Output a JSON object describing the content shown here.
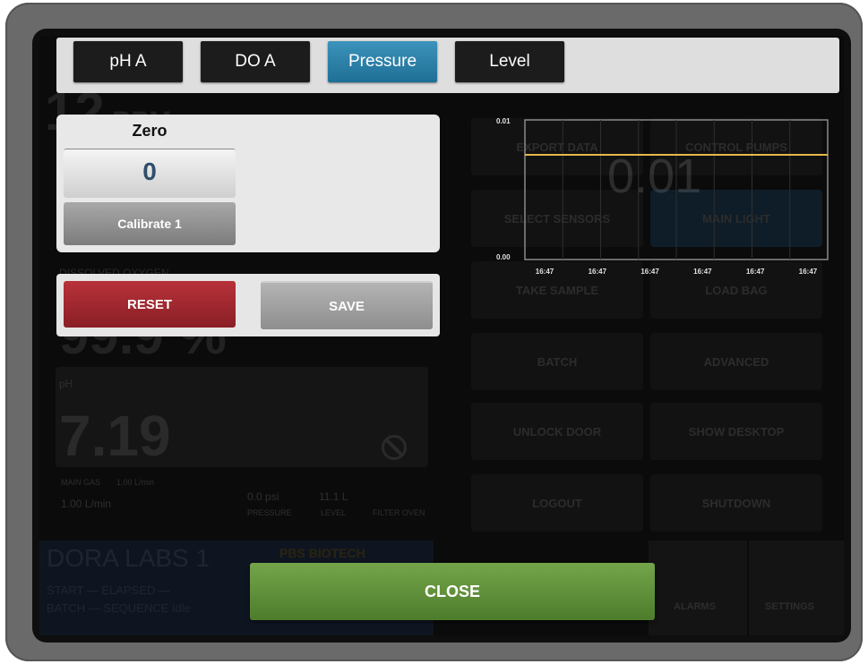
{
  "tabs": [
    {
      "label": "pH A",
      "active": false
    },
    {
      "label": "DO A",
      "active": false
    },
    {
      "label": "Pressure",
      "active": true
    },
    {
      "label": "Level",
      "active": false
    }
  ],
  "calibration": {
    "zero_title": "Zero",
    "zero_value": "0",
    "calibrate_label": "Calibrate 1"
  },
  "actions": {
    "reset_label": "RESET",
    "save_label": "SAVE"
  },
  "close_label": "CLOSE",
  "background": {
    "rpm_value": "12",
    "rpm_unit": "RPM",
    "do_label": "DISSOLVED OXYGEN",
    "do_value": "99.9 %",
    "ph_label": "pH",
    "ph_value": "7.19",
    "main_gas_label": "MAIN GAS",
    "main_gas_setpoint": "1.00 L/min",
    "main_gas_value": "1.00 L/min",
    "pressure_value": "0.0 psi",
    "pressure_label": "PRESSURE",
    "level_value": "11.1 L",
    "level_label": "LEVEL",
    "filter_label": "FILTER OVEN",
    "tiles": [
      "EXPORT DATA",
      "CONTROL PUMPS",
      "SELECT SENSORS",
      "MAIN LIGHT",
      "TAKE SAMPLE",
      "LOAD BAG",
      "BATCH",
      "ADVANCED",
      "UNLOCK DOOR",
      "SHOW DESKTOP",
      "LOGOUT",
      "SHUTDOWN"
    ],
    "unit_name": "DORA LABS 1",
    "brand": "PBS BIOTECH",
    "start_line": "START  —  ELAPSED  —",
    "batch_line": "BATCH  —  SEQUENCE  Idle",
    "alarms_label": "ALARMS",
    "settings_label": "SETTINGS"
  },
  "chart_data": {
    "type": "line",
    "title": "",
    "big_value": "0.01",
    "x": [
      "16:47",
      "16:47",
      "16:47",
      "16:47",
      "16:47",
      "16:47"
    ],
    "series": [
      {
        "values": [
          0.0075,
          0.0075,
          0.0075,
          0.0075,
          0.0075,
          0.0075
        ],
        "color": "#e8b84a"
      }
    ],
    "ylim": [
      0.0,
      0.01
    ],
    "y_ticks": [
      "0.01",
      "0.00"
    ],
    "grid": true,
    "line_color": "#e8b84a"
  }
}
